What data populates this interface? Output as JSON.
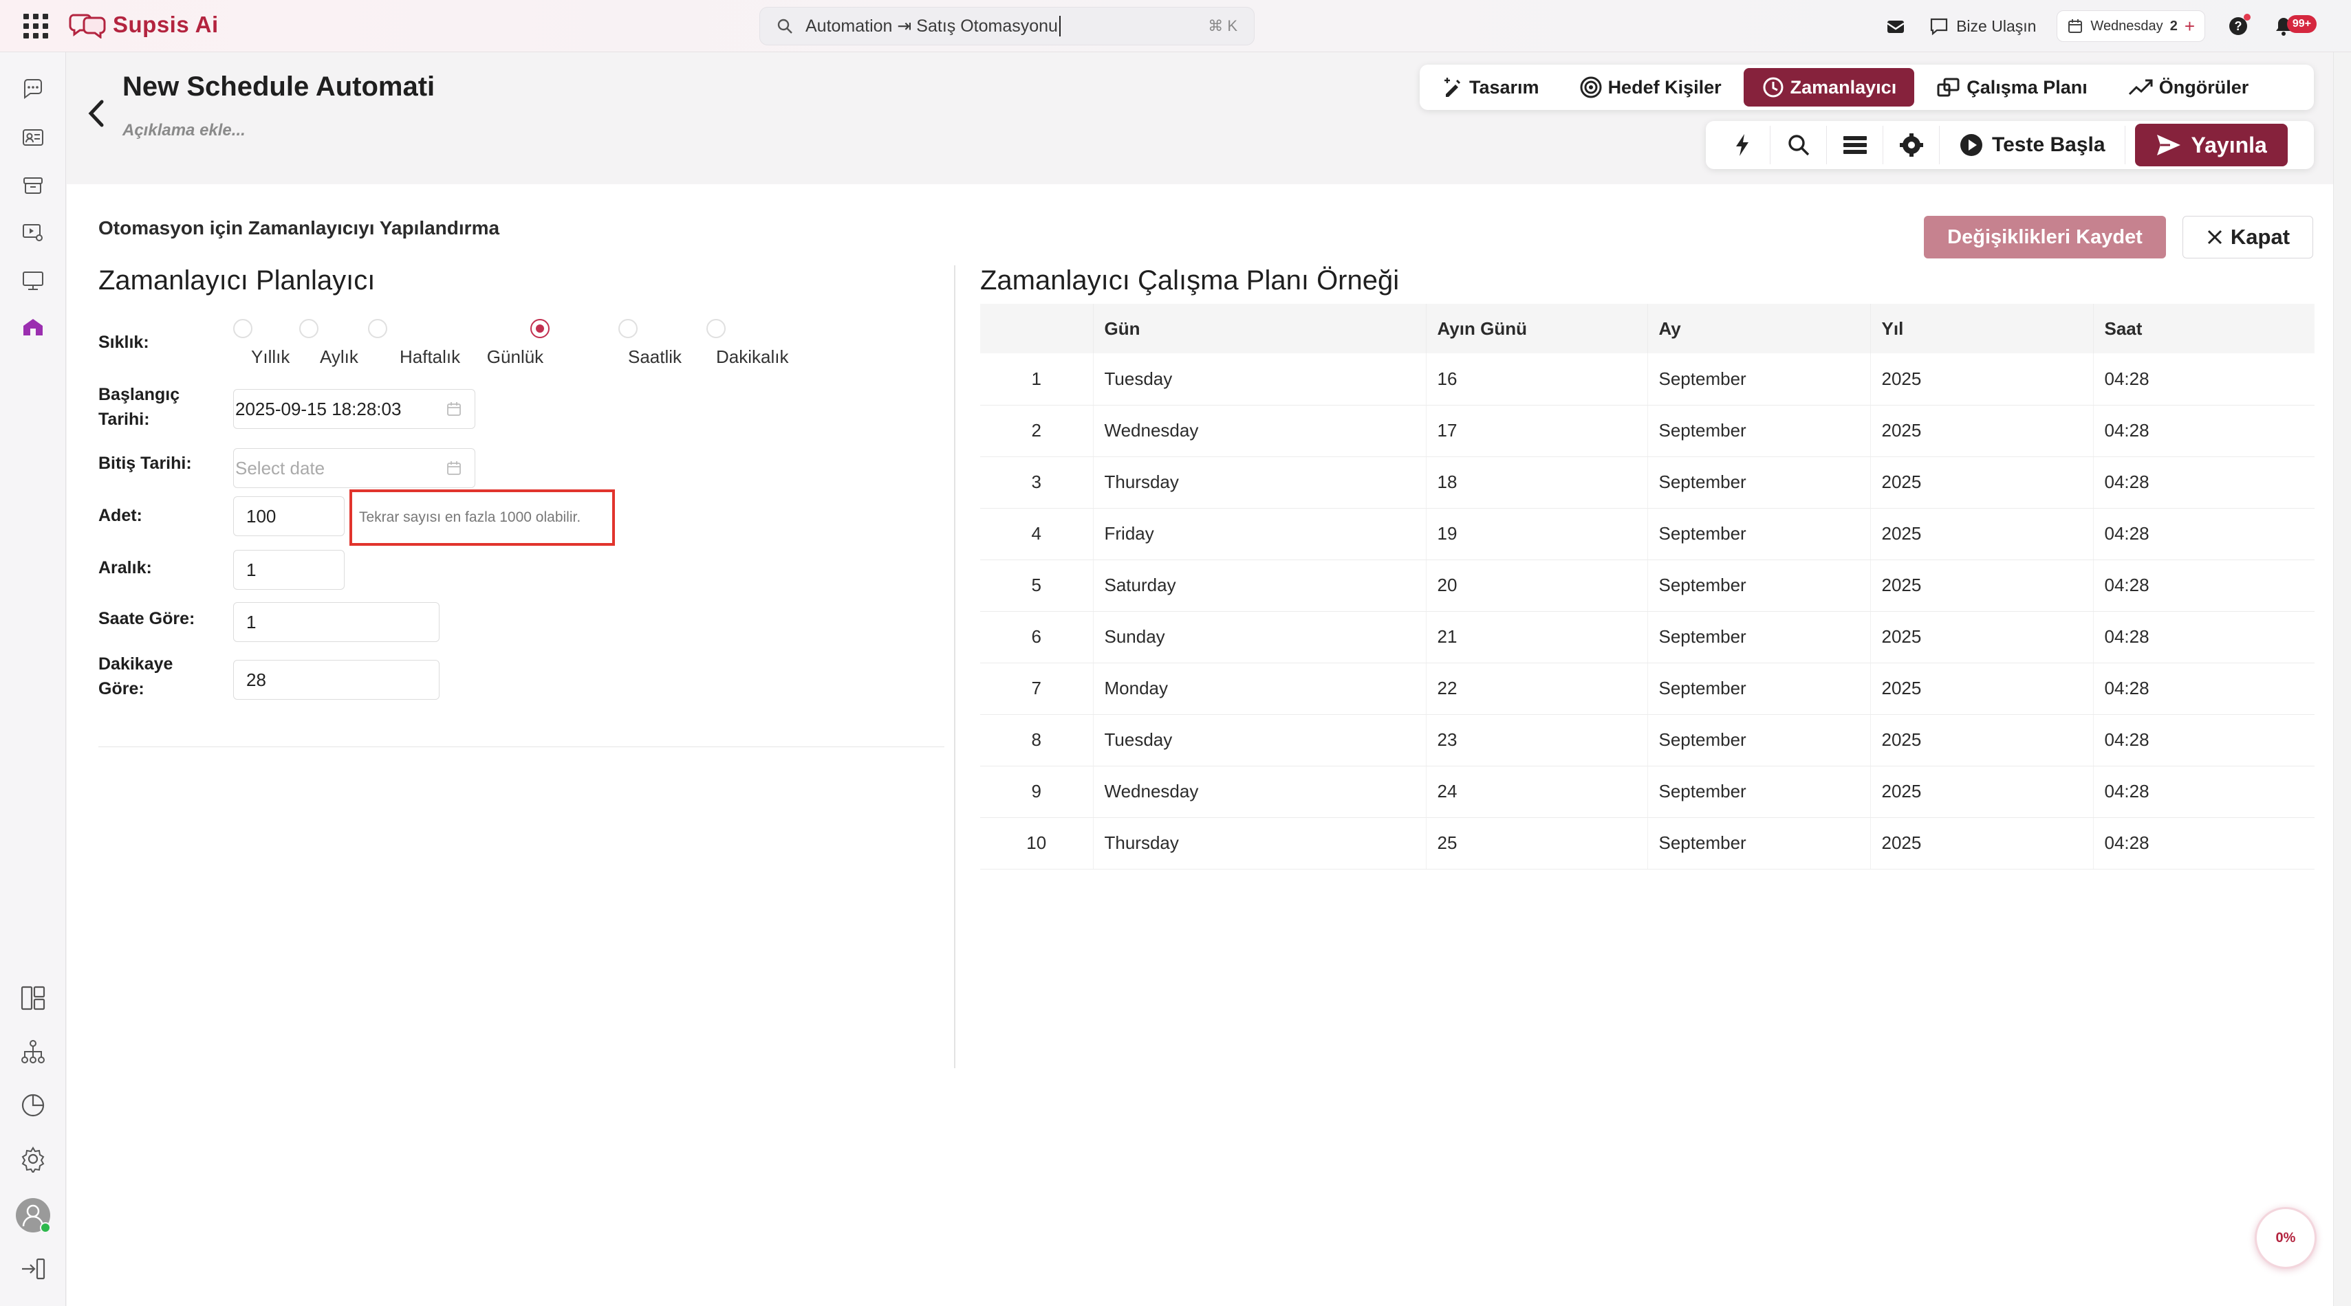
{
  "app": {
    "name": "Supsis Ai"
  },
  "search": {
    "text": "Automation ⇥ Satış Otomasyonu",
    "shortcut": "⌘ K"
  },
  "topbar": {
    "contact_label": "Bize Ulaşın",
    "date_day": "Wednesday",
    "date_num": "2",
    "notifications_badge": "99+"
  },
  "page": {
    "title": "New Schedule Automati",
    "description": "Açıklama ekle..."
  },
  "tabs": [
    {
      "label": "Tasarım",
      "icon": "design-icon",
      "active": false
    },
    {
      "label": "Hedef Kişiler",
      "icon": "target-icon",
      "active": false
    },
    {
      "label": "Zamanlayıcı",
      "icon": "clock-icon",
      "active": true
    },
    {
      "label": "Çalışma Planı",
      "icon": "workplan-icon",
      "active": false
    },
    {
      "label": "Öngörüler",
      "icon": "insights-icon",
      "active": false
    }
  ],
  "toolbar": {
    "test_label": "Teste Başla",
    "publish_label": "Yayınla"
  },
  "panel": {
    "title": "Otomasyon için Zamanlayıcıyı Yapılandırma",
    "save_label": "Değişiklikleri Kaydet",
    "close_label": "Kapat",
    "left_title": "Zamanlayıcı Planlayıcı",
    "right_title": "Zamanlayıcı Çalışma Planı Örneği"
  },
  "form": {
    "frequency_label": "Sıklık:",
    "frequency_options": [
      "Yıllık",
      "Aylık",
      "Haftalık",
      "Günlük",
      "Saatlik",
      "Dakikalık"
    ],
    "frequency_selected": "Günlük",
    "start_label_1": "Başlangıç",
    "start_label_2": "Tarihi:",
    "start_value": "2025-09-15 18:28:03",
    "end_label": "Bitiş Tarihi:",
    "end_placeholder": "Select date",
    "count_label": "Adet:",
    "count_value": "100",
    "count_warning": "Tekrar sayısı en fazla 1000 olabilir.",
    "interval_label": "Aralık:",
    "interval_value": "1",
    "hour_label": "Saate Göre:",
    "hour_value": "1",
    "minute_label_1": "Dakikaye",
    "minute_label_2": "Göre:",
    "minute_value": "28"
  },
  "table": {
    "headers": [
      "",
      "Gün",
      "Ayın Günü",
      "Ay",
      "Yıl",
      "Saat"
    ],
    "rows": [
      [
        "1",
        "Tuesday",
        "16",
        "September",
        "2025",
        "04:28"
      ],
      [
        "2",
        "Wednesday",
        "17",
        "September",
        "2025",
        "04:28"
      ],
      [
        "3",
        "Thursday",
        "18",
        "September",
        "2025",
        "04:28"
      ],
      [
        "4",
        "Friday",
        "19",
        "September",
        "2025",
        "04:28"
      ],
      [
        "5",
        "Saturday",
        "20",
        "September",
        "2025",
        "04:28"
      ],
      [
        "6",
        "Sunday",
        "21",
        "September",
        "2025",
        "04:28"
      ],
      [
        "7",
        "Monday",
        "22",
        "September",
        "2025",
        "04:28"
      ],
      [
        "8",
        "Tuesday",
        "23",
        "September",
        "2025",
        "04:28"
      ],
      [
        "9",
        "Wednesday",
        "24",
        "September",
        "2025",
        "04:28"
      ],
      [
        "10",
        "Thursday",
        "25",
        "September",
        "2025",
        "04:28"
      ]
    ]
  },
  "progress": {
    "label": "0%"
  },
  "colors": {
    "brand": "#b3243f",
    "accent": "#86223c",
    "warning_border": "#e1342d"
  }
}
